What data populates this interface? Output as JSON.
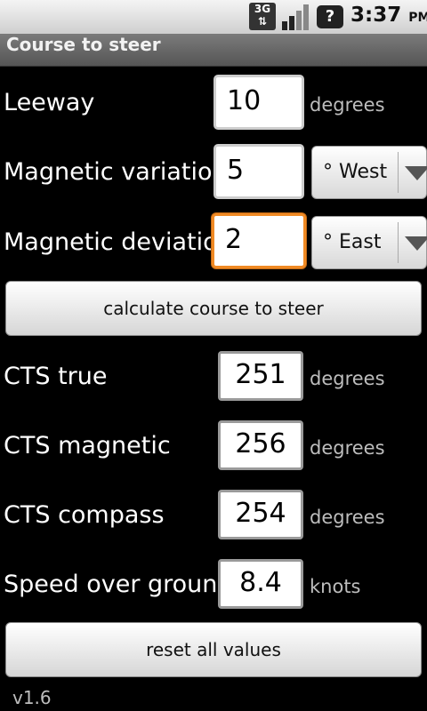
{
  "status_bar": {
    "network": "3G",
    "time": "3:37",
    "ampm": "PM",
    "icons": [
      "3g-data-icon",
      "signal-icon",
      "unknown-sim-icon"
    ]
  },
  "title_bar": {
    "title": "Course to steer"
  },
  "inputs": {
    "leeway": {
      "label": "Leeway",
      "value": "10",
      "unit": "degrees"
    },
    "variation": {
      "label": "Magnetic variation",
      "value": "5",
      "direction": "° West"
    },
    "deviation": {
      "label": "Magnetic deviation",
      "value": "2",
      "direction": "° East"
    }
  },
  "calculate_button": {
    "label": "calculate course to steer"
  },
  "results": {
    "cts_true": {
      "label": "CTS true",
      "value": "251",
      "unit": "degrees"
    },
    "cts_magnetic": {
      "label": "CTS magnetic",
      "value": "256",
      "unit": "degrees"
    },
    "cts_compass": {
      "label": "CTS compass",
      "value": "254",
      "unit": "degrees"
    },
    "sog": {
      "label": "Speed over ground",
      "value": "8.4",
      "unit": "knots"
    }
  },
  "reset_button": {
    "label": "reset all values"
  },
  "version": "v1.6",
  "colors": {
    "focus": "#f08a24",
    "background": "#000000",
    "title_bar": "#6a6a6a"
  }
}
